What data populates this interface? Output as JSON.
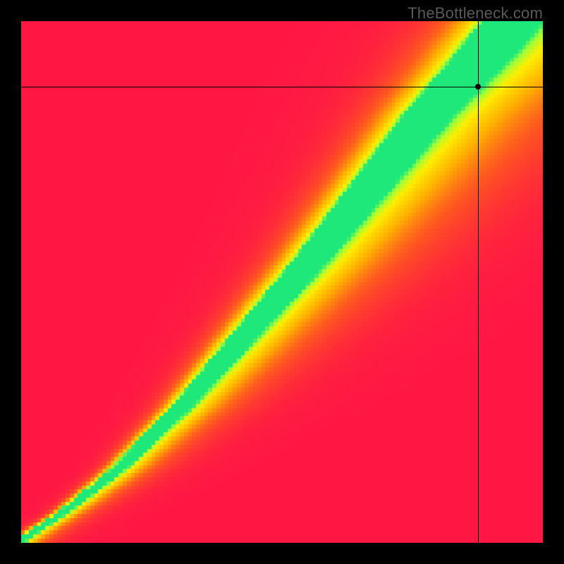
{
  "watermark": "TheBottleneck.com",
  "chart_data": {
    "type": "heatmap",
    "title": "",
    "xlabel": "",
    "ylabel": "",
    "xlim": [
      0,
      100
    ],
    "ylim": [
      0,
      100
    ],
    "crosshair": {
      "x": 87.5,
      "y": 87.5
    },
    "marker": {
      "x": 87.5,
      "y": 87.5
    },
    "colorscale": [
      {
        "stop": 0.0,
        "color": "#ff1744"
      },
      {
        "stop": 0.25,
        "color": "#ff5a1f"
      },
      {
        "stop": 0.5,
        "color": "#ffb300"
      },
      {
        "stop": 0.75,
        "color": "#ffee00"
      },
      {
        "stop": 0.9,
        "color": "#9cff3a"
      },
      {
        "stop": 1.0,
        "color": "#00e28a"
      }
    ],
    "ridge": {
      "description": "Optimal-performance ridge where z≈1 (green). Approximate (x,y) waypoints in percent of axis range.",
      "points": [
        [
          2,
          2
        ],
        [
          8,
          6
        ],
        [
          18,
          14
        ],
        [
          30,
          26
        ],
        [
          42,
          40
        ],
        [
          54,
          54
        ],
        [
          65,
          68
        ],
        [
          76,
          82
        ],
        [
          85,
          92
        ],
        [
          90,
          98
        ]
      ],
      "half_width_pct_at_y": [
        {
          "y": 5,
          "hw": 1.5
        },
        {
          "y": 20,
          "hw": 2.5
        },
        {
          "y": 40,
          "hw": 4.0
        },
        {
          "y": 60,
          "hw": 5.5
        },
        {
          "y": 80,
          "hw": 7.0
        },
        {
          "y": 95,
          "hw": 8.5
        }
      ]
    },
    "asymmetry": {
      "description": "Heat falls off faster on the left side of the ridge than the right.",
      "left_falloff_multiplier": 2.8,
      "right_falloff_multiplier": 1.0
    },
    "grid_resolution": 128
  }
}
